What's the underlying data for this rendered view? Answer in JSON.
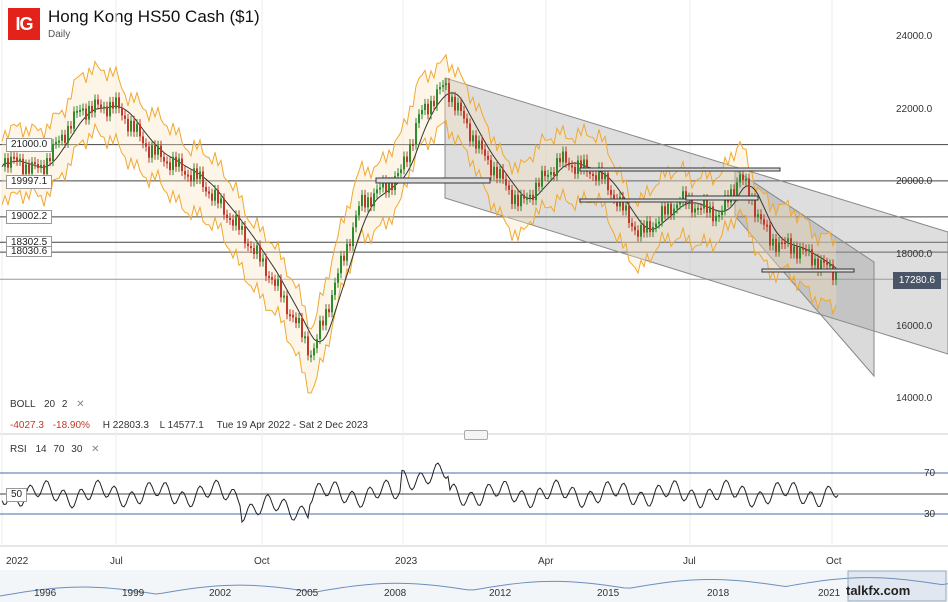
{
  "header": {
    "logo": "IG",
    "title": "Hong Kong HS50 Cash ($1)",
    "timeframe": "Daily"
  },
  "price_axis": {
    "labels": [
      "24000.0",
      "22000.0",
      "20000.0",
      "18000.0",
      "16000.0",
      "14000.0"
    ],
    "current_price": "17280.6"
  },
  "level_labels": [
    "21000.0",
    "19997.1",
    "19002.2",
    "18302.5",
    "18030.6"
  ],
  "indicators": {
    "boll": {
      "name": "BOLL",
      "p1": "20",
      "p2": "2"
    },
    "stats": {
      "change": "-4027.3",
      "change_pct": "-18.90%",
      "high": "H 22803.3",
      "low": "L 14577.1",
      "range": "Tue 19 Apr 2022 - Sat 2 Dec 2023"
    },
    "rsi": {
      "name": "RSI",
      "p1": "14",
      "p2": "70",
      "p3": "30"
    },
    "rsi_levels": [
      "70",
      "50",
      "30"
    ]
  },
  "time_axis": [
    "2022",
    "Jul",
    "Oct",
    "2023",
    "Apr",
    "Jul",
    "Oct"
  ],
  "navigator": [
    "1996",
    "1999",
    "2002",
    "2005",
    "2008",
    "2012",
    "2015",
    "2018",
    "2021"
  ],
  "watermark": "talkfx.com",
  "colors": {
    "brand": "#e2231a",
    "bull": "#2e8b2e",
    "bear": "#c0392b",
    "boll": "#f0a830",
    "channel": "#b8b8b8",
    "price_tag": "#4a5568"
  }
}
